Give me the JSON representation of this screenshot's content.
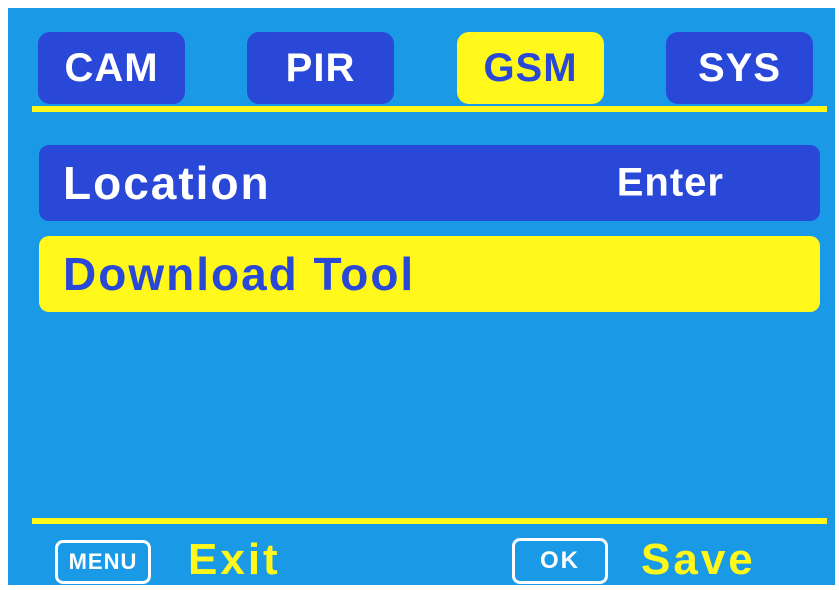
{
  "tabs": [
    {
      "label": "CAM",
      "active": false
    },
    {
      "label": "PIR",
      "active": false
    },
    {
      "label": "GSM",
      "active": true
    },
    {
      "label": "SYS",
      "active": false
    }
  ],
  "menu_items": [
    {
      "label": "Location",
      "value": "Enter",
      "selected": false
    },
    {
      "label": "Download Tool",
      "value": "",
      "selected": true
    }
  ],
  "footer": {
    "menu_key": "MENU",
    "menu_action": "Exit",
    "ok_key": "OK",
    "ok_action": "Save"
  },
  "colors": {
    "background": "#1a9ae6",
    "tab_blue": "#2a48d8",
    "highlight_yellow": "#fff81a",
    "text_white": "#ffffff"
  }
}
